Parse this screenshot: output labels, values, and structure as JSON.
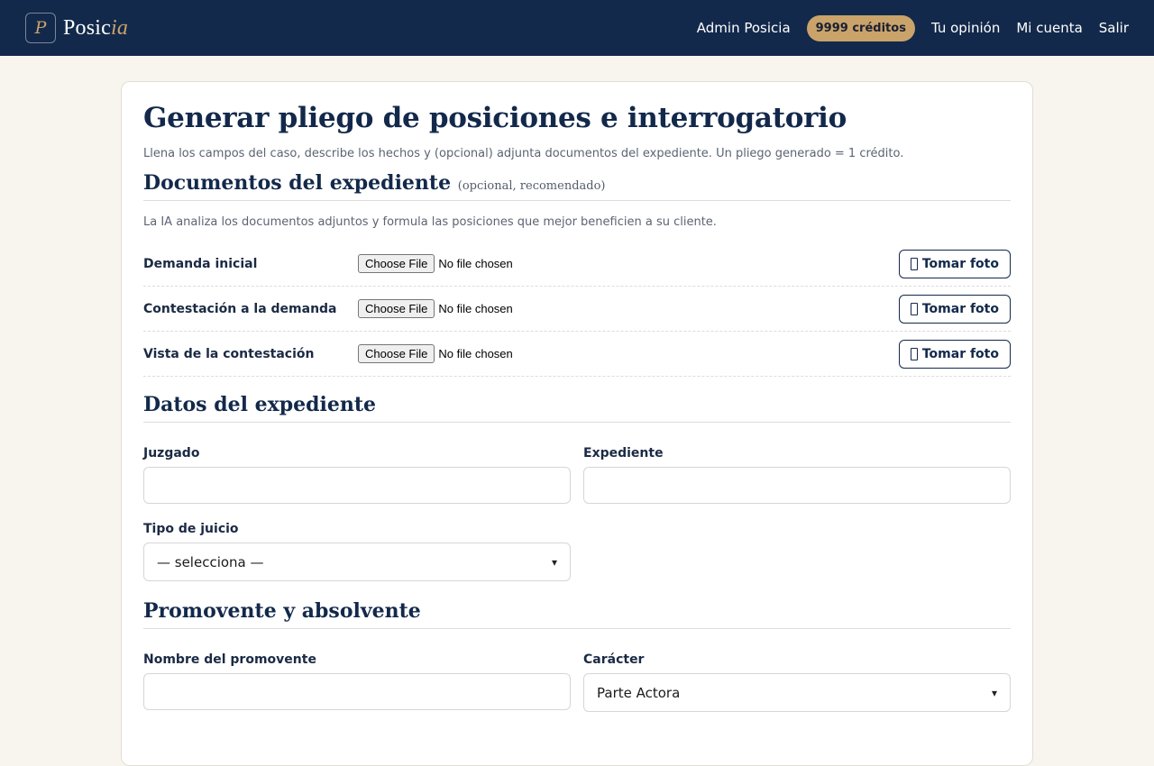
{
  "header": {
    "logo_letter": "P",
    "brand_main": "Posic",
    "brand_accent": "ia",
    "nav": {
      "admin": "Admin Posicia",
      "credits": "9999 créditos",
      "opinion": "Tu opinión",
      "account": "Mi cuenta",
      "logout": "Salir"
    }
  },
  "page": {
    "title": "Generar pliego de posiciones e interrogatorio",
    "subtitle": "Llena los campos del caso, describe los hechos y (opcional) adjunta documentos del expediente. Un pliego generado = 1 crédito."
  },
  "documents": {
    "title": "Documentos del expediente",
    "note": "(opcional, recomendado)",
    "description": "La IA analiza los documentos adjuntos y formula las posiciones que mejor beneficien a su cliente.",
    "rows": [
      {
        "label": "Demanda inicial",
        "file_button": "Choose File",
        "file_status": "No file chosen",
        "photo_button": "Tomar foto"
      },
      {
        "label": "Contestación a la demanda",
        "file_button": "Choose File",
        "file_status": "No file chosen",
        "photo_button": "Tomar foto"
      },
      {
        "label": "Vista de la contestación",
        "file_button": "Choose File",
        "file_status": "No file chosen",
        "photo_button": "Tomar foto"
      }
    ]
  },
  "datos": {
    "title": "Datos del expediente",
    "juzgado_label": "Juzgado",
    "juzgado_value": "",
    "expediente_label": "Expediente",
    "expediente_value": "",
    "tipo_label": "Tipo de juicio",
    "tipo_selected": "— selecciona —"
  },
  "promovente": {
    "title": "Promovente y absolvente",
    "nombre_label": "Nombre del promovente",
    "nombre_value": "",
    "caracter_label": "Carácter",
    "caracter_selected": "Parte Actora"
  },
  "colors": {
    "navy": "#13294b",
    "gold": "#c9a36a",
    "page_bg": "#f8f5ef"
  }
}
